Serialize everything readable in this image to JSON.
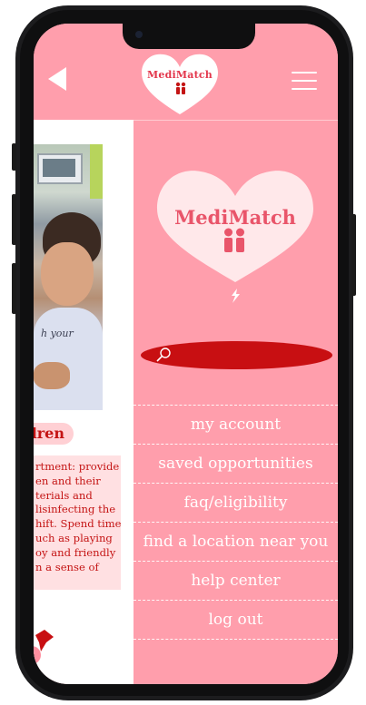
{
  "app": {
    "brand": "MediMatch"
  },
  "header": {
    "logo_text": "MediMatch",
    "back_icon": "back-triangle-icon",
    "menu_icon": "hamburger-icon"
  },
  "content": {
    "tag": "dren",
    "description_lines": [
      "rtment: provide",
      "en and their",
      "terials and",
      "lisinfecting the",
      "hift. Spend time",
      "uch as playing",
      "oy and friendly",
      "n a sense of"
    ],
    "photo_shirt_text": "h your"
  },
  "menu": {
    "logo_text": "MediMatch",
    "search_placeholder": "",
    "items": [
      {
        "label": "my account"
      },
      {
        "label": "saved opportunities"
      },
      {
        "label": "faq/eligibility"
      },
      {
        "label": "find a location near you"
      },
      {
        "label": "help center"
      },
      {
        "label": "log out"
      }
    ]
  },
  "colors": {
    "primary_pink": "#ff9eac",
    "accent_red": "#c80f12",
    "text_red": "#c41414",
    "heart_fill": "#ffe8ea",
    "logo_text": "#e9556a"
  }
}
